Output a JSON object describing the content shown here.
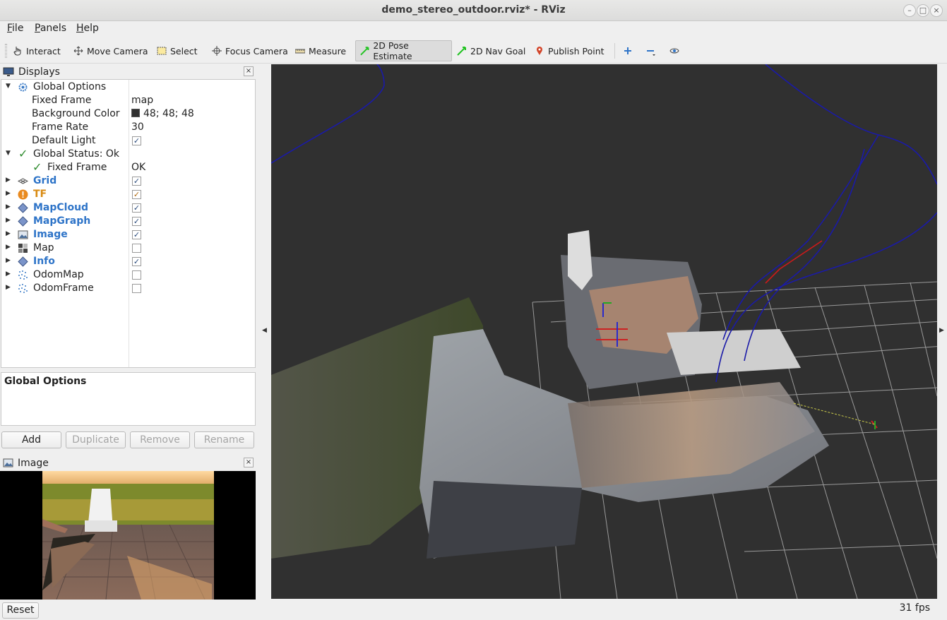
{
  "window": {
    "title": "demo_stereo_outdoor.rviz* - RViz"
  },
  "menu": [
    {
      "underline": "F",
      "rest": "ile"
    },
    {
      "underline": "P",
      "rest": "anels"
    },
    {
      "underline": "H",
      "rest": "elp"
    }
  ],
  "toolbar": {
    "interact": "Interact",
    "move_camera": "Move Camera",
    "select": "Select",
    "focus_camera": "Focus Camera",
    "measure": "Measure",
    "pose_estimate": "2D Pose Estimate",
    "nav_goal": "2D Nav Goal",
    "publish_point": "Publish Point"
  },
  "displays": {
    "title": "Displays",
    "global_options": "Global Options",
    "fixed_frame_label": "Fixed Frame",
    "fixed_frame_value": "map",
    "bg_color_label": "Background Color",
    "bg_color_value": "48; 48; 48",
    "frame_rate_label": "Frame Rate",
    "frame_rate_value": "30",
    "default_light_label": "Default Light",
    "global_status": "Global Status: Ok",
    "status_fixed_frame_label": "Fixed Frame",
    "status_fixed_frame_value": "OK",
    "items": [
      {
        "label": "Grid",
        "checked": true,
        "style": "blue"
      },
      {
        "label": "TF",
        "checked": true,
        "style": "orange"
      },
      {
        "label": "MapCloud",
        "checked": true,
        "style": "blue"
      },
      {
        "label": "MapGraph",
        "checked": true,
        "style": "blue"
      },
      {
        "label": "Image",
        "checked": true,
        "style": "blue"
      },
      {
        "label": "Map",
        "checked": false,
        "style": "plain"
      },
      {
        "label": "Info",
        "checked": true,
        "style": "blue"
      },
      {
        "label": "OdomMap",
        "checked": false,
        "style": "plain"
      },
      {
        "label": "OdomFrame",
        "checked": false,
        "style": "plain"
      }
    ]
  },
  "description": {
    "title": "Global Options"
  },
  "buttons": {
    "add": "Add",
    "duplicate": "Duplicate",
    "remove": "Remove",
    "rename": "Rename"
  },
  "image_panel": {
    "title": "Image"
  },
  "status": {
    "reset": "Reset",
    "fps": "31 fps"
  },
  "colors": {
    "background": "#303030",
    "accent_blue": "#2e74c8",
    "warning_orange": "#d88a11",
    "path_blue": "#1a1aa8",
    "path_red": "#cc1a1a"
  }
}
